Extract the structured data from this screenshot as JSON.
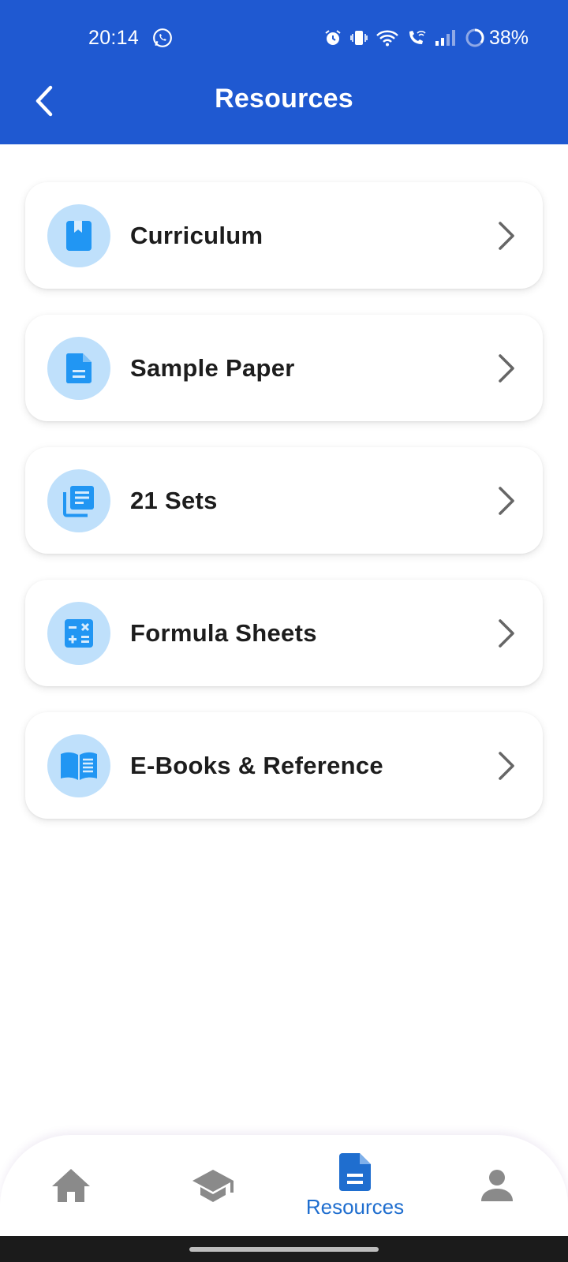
{
  "status_bar": {
    "time": "20:14",
    "battery": "38%",
    "icons": [
      "whatsapp-icon",
      "alarm-icon",
      "vibrate-icon",
      "wifi-icon",
      "wifi-call-icon",
      "signal-icon",
      "battery-icon"
    ]
  },
  "app_bar": {
    "title": "Resources",
    "back_icon": "arrow-back-icon"
  },
  "resources": [
    {
      "label": "Curriculum",
      "icon": "book-icon"
    },
    {
      "label": "Sample Paper",
      "icon": "document-icon"
    },
    {
      "label": "21 Sets",
      "icon": "library-books-icon"
    },
    {
      "label": "Formula Sheets",
      "icon": "calculator-icon"
    },
    {
      "label": "E-Books & Reference",
      "icon": "open-book-icon"
    }
  ],
  "bottom_nav": {
    "items": [
      {
        "id": "home",
        "icon": "home-icon",
        "label": ""
      },
      {
        "id": "courses",
        "icon": "graduation-cap-icon",
        "label": ""
      },
      {
        "id": "resources",
        "icon": "document-icon",
        "label": "Resources",
        "active": true
      },
      {
        "id": "profile",
        "icon": "person-icon",
        "label": ""
      }
    ]
  },
  "colors": {
    "primary": "#1f59d1",
    "icon_accent": "#2196f3",
    "icon_badge_bg": "#bfe0fb",
    "nav_active": "#1f6ecf",
    "nav_inactive": "#8a8a8a"
  }
}
